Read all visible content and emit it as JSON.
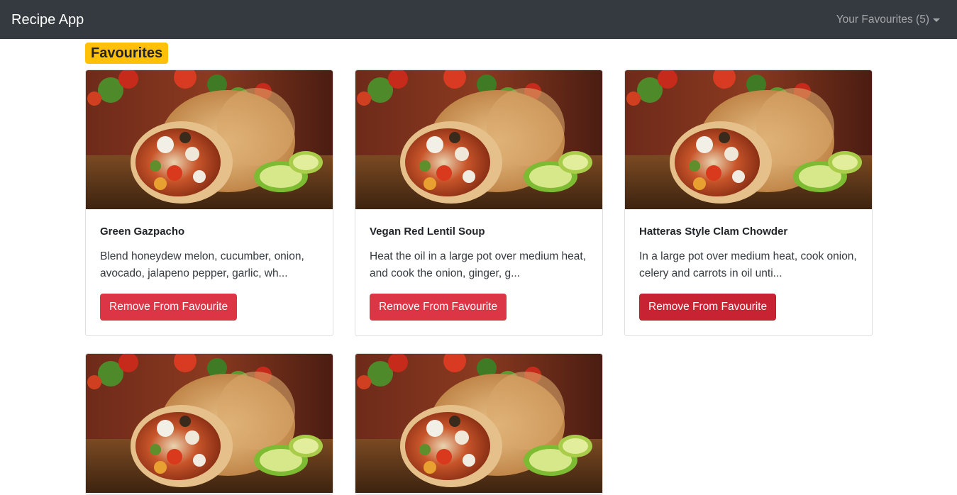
{
  "navbar": {
    "brand": "Recipe App",
    "favourites_menu": "Your Favourites (5)"
  },
  "page": {
    "heading": "Favourites"
  },
  "cards": [
    {
      "title": "Green Gazpacho",
      "description": "Blend honeydew melon, cucumber, onion, avocado, jalapeno pepper, garlic, wh...",
      "button_label": "Remove From Favourite",
      "image": "burrito-image"
    },
    {
      "title": "Vegan Red Lentil Soup",
      "description": "Heat the oil in a large pot over medium heat, and cook the onion, ginger, g...",
      "button_label": "Remove From Favourite",
      "image": "burrito-image"
    },
    {
      "title": "Hatteras Style Clam Chowder",
      "description": "In a large pot over medium heat, cook onion, celery and carrots in oil unti...",
      "button_label": "Remove From Favourite",
      "image": "burrito-image"
    },
    {
      "image": "burrito-image"
    },
    {
      "image": "burrito-image"
    }
  ],
  "colors": {
    "navbar_bg": "#343a40",
    "heading_badge": "#ffc107",
    "danger_button": "#dc3545",
    "danger_button_hover": "#c82333"
  }
}
